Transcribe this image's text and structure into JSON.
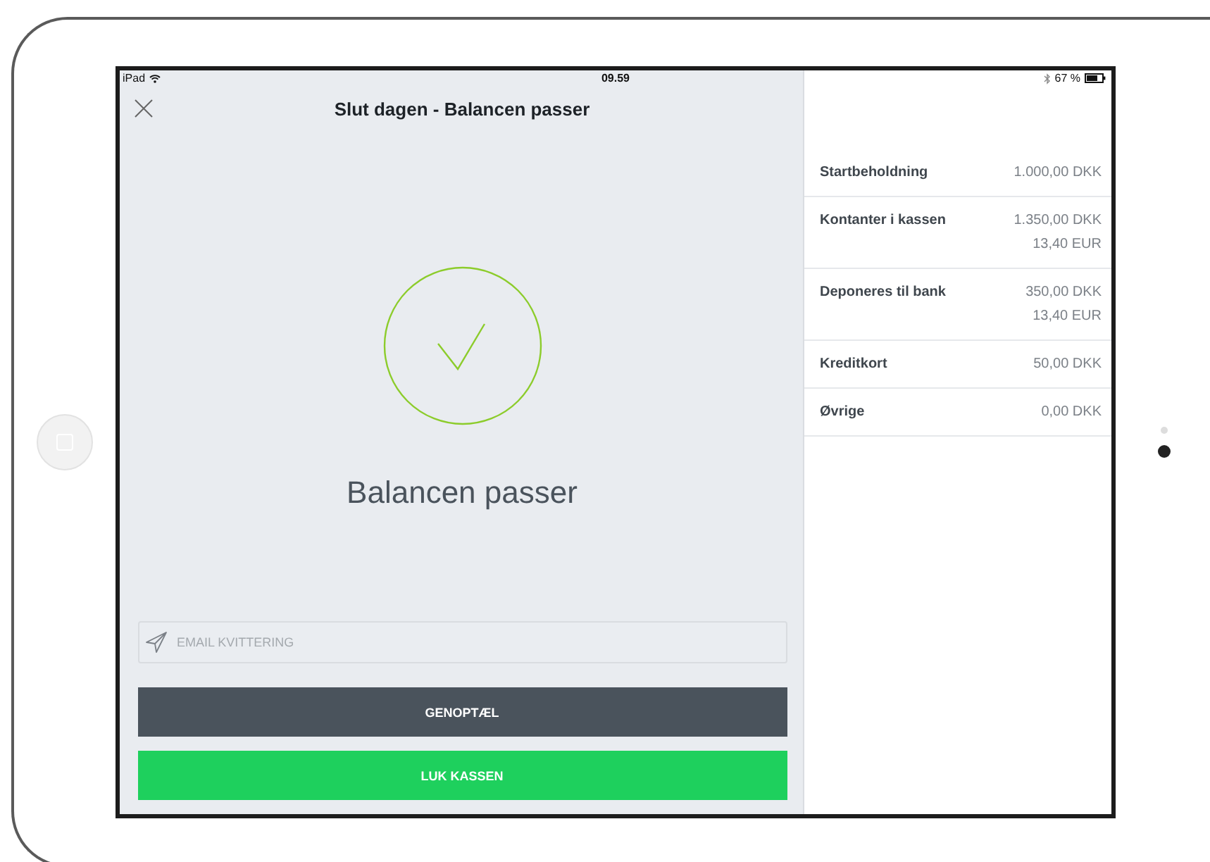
{
  "status_bar": {
    "device": "iPad",
    "time": "09.59",
    "battery": "67 %"
  },
  "header": {
    "title": "Slut dagen - Balancen passer"
  },
  "result": {
    "message": "Balancen passer"
  },
  "email_field": {
    "placeholder": "EMAIL KVITTERING"
  },
  "buttons": [
    {
      "label": "GENOPTÆL",
      "kind": "secondary"
    },
    {
      "label": "LUK KASSEN",
      "kind": "primary"
    }
  ],
  "summary": [
    {
      "label": "Startbeholdning",
      "values": [
        "1.000,00 DKK"
      ]
    },
    {
      "label": "Kontanter i kassen",
      "values": [
        "1.350,00 DKK",
        "13,40 EUR"
      ]
    },
    {
      "label": "Deponeres til bank",
      "values": [
        "350,00 DKK",
        "13,40 EUR"
      ]
    },
    {
      "label": "Kreditkort",
      "values": [
        "50,00 DKK"
      ]
    },
    {
      "label": "Øvrige",
      "values": [
        "0,00 DKK"
      ]
    }
  ]
}
